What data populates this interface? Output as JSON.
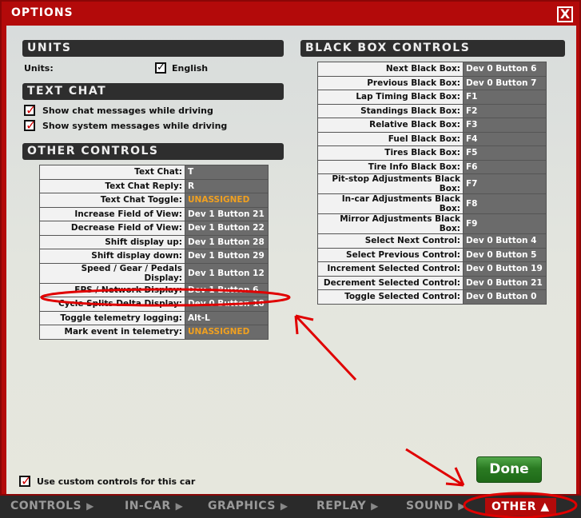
{
  "window": {
    "title": "OPTIONS",
    "close_label": "X"
  },
  "units": {
    "header": "UNITS",
    "label": "Units:",
    "option": "English",
    "checked": true
  },
  "text_chat": {
    "header": "TEXT CHAT",
    "items": [
      {
        "label": "Show chat messages while driving",
        "checked": true
      },
      {
        "label": "Show system messages while driving",
        "checked": true
      }
    ]
  },
  "other_controls": {
    "header": "OTHER CONTROLS",
    "rows": [
      {
        "label": "Text Chat:",
        "value": "T"
      },
      {
        "label": "Text Chat Reply:",
        "value": "R"
      },
      {
        "label": "Text Chat Toggle:",
        "value": "UNASSIGNED"
      },
      {
        "label": "Increase Field of View:",
        "value": "Dev 1 Button 21"
      },
      {
        "label": "Decrease Field of View:",
        "value": "Dev 1 Button 22"
      },
      {
        "label": "Shift display up:",
        "value": "Dev 1 Button 28"
      },
      {
        "label": "Shift display down:",
        "value": "Dev 1 Button 29"
      },
      {
        "label": "Speed / Gear / Pedals Display:",
        "value": "Dev 1 Button 12"
      },
      {
        "label": "FPS / Network Display:",
        "value": "Dev 1 Button 6"
      },
      {
        "label": "Cycle Splits Delta Display:",
        "value": "Dev 0 Button 18"
      },
      {
        "label": "Toggle telemetry logging:",
        "value": "Alt-L"
      },
      {
        "label": "Mark event in telemetry:",
        "value": "UNASSIGNED"
      }
    ]
  },
  "black_box": {
    "header": "BLACK BOX CONTROLS",
    "rows": [
      {
        "label": "Next Black Box:",
        "value": "Dev 0 Button 6"
      },
      {
        "label": "Previous Black Box:",
        "value": "Dev 0 Button 7"
      },
      {
        "label": "Lap Timing Black Box:",
        "value": "F1"
      },
      {
        "label": "Standings Black Box:",
        "value": "F2"
      },
      {
        "label": "Relative Black Box:",
        "value": "F3"
      },
      {
        "label": "Fuel Black Box:",
        "value": "F4"
      },
      {
        "label": "Tires Black Box:",
        "value": "F5"
      },
      {
        "label": "Tire Info Black Box:",
        "value": "F6"
      },
      {
        "label": "Pit-stop Adjustments Black Box:",
        "value": "F7"
      },
      {
        "label": "In-car Adjustments Black Box:",
        "value": "F8"
      },
      {
        "label": "Mirror Adjustments Black Box:",
        "value": "F9"
      },
      {
        "label": "Select Next Control:",
        "value": "Dev 0 Button 4"
      },
      {
        "label": "Select Previous Control:",
        "value": "Dev 0 Button 5"
      },
      {
        "label": "Increment Selected Control:",
        "value": "Dev 0 Button 19"
      },
      {
        "label": "Decrement Selected Control:",
        "value": "Dev 0 Button 21"
      },
      {
        "label": "Toggle Selected Control:",
        "value": "Dev 0 Button 0"
      }
    ]
  },
  "custom_controls": {
    "label": "Use custom controls for this car",
    "checked": true
  },
  "done_label": "Done",
  "tabs": [
    {
      "label": "CONTROLS"
    },
    {
      "label": "IN-CAR"
    },
    {
      "label": "GRAPHICS"
    },
    {
      "label": "REPLAY"
    },
    {
      "label": "SOUND"
    },
    {
      "label": "OTHER ▲",
      "active": true
    }
  ],
  "colors": {
    "accent": "#b30a0a",
    "unassigned": "#f0a020",
    "done": "#2a7a22"
  }
}
